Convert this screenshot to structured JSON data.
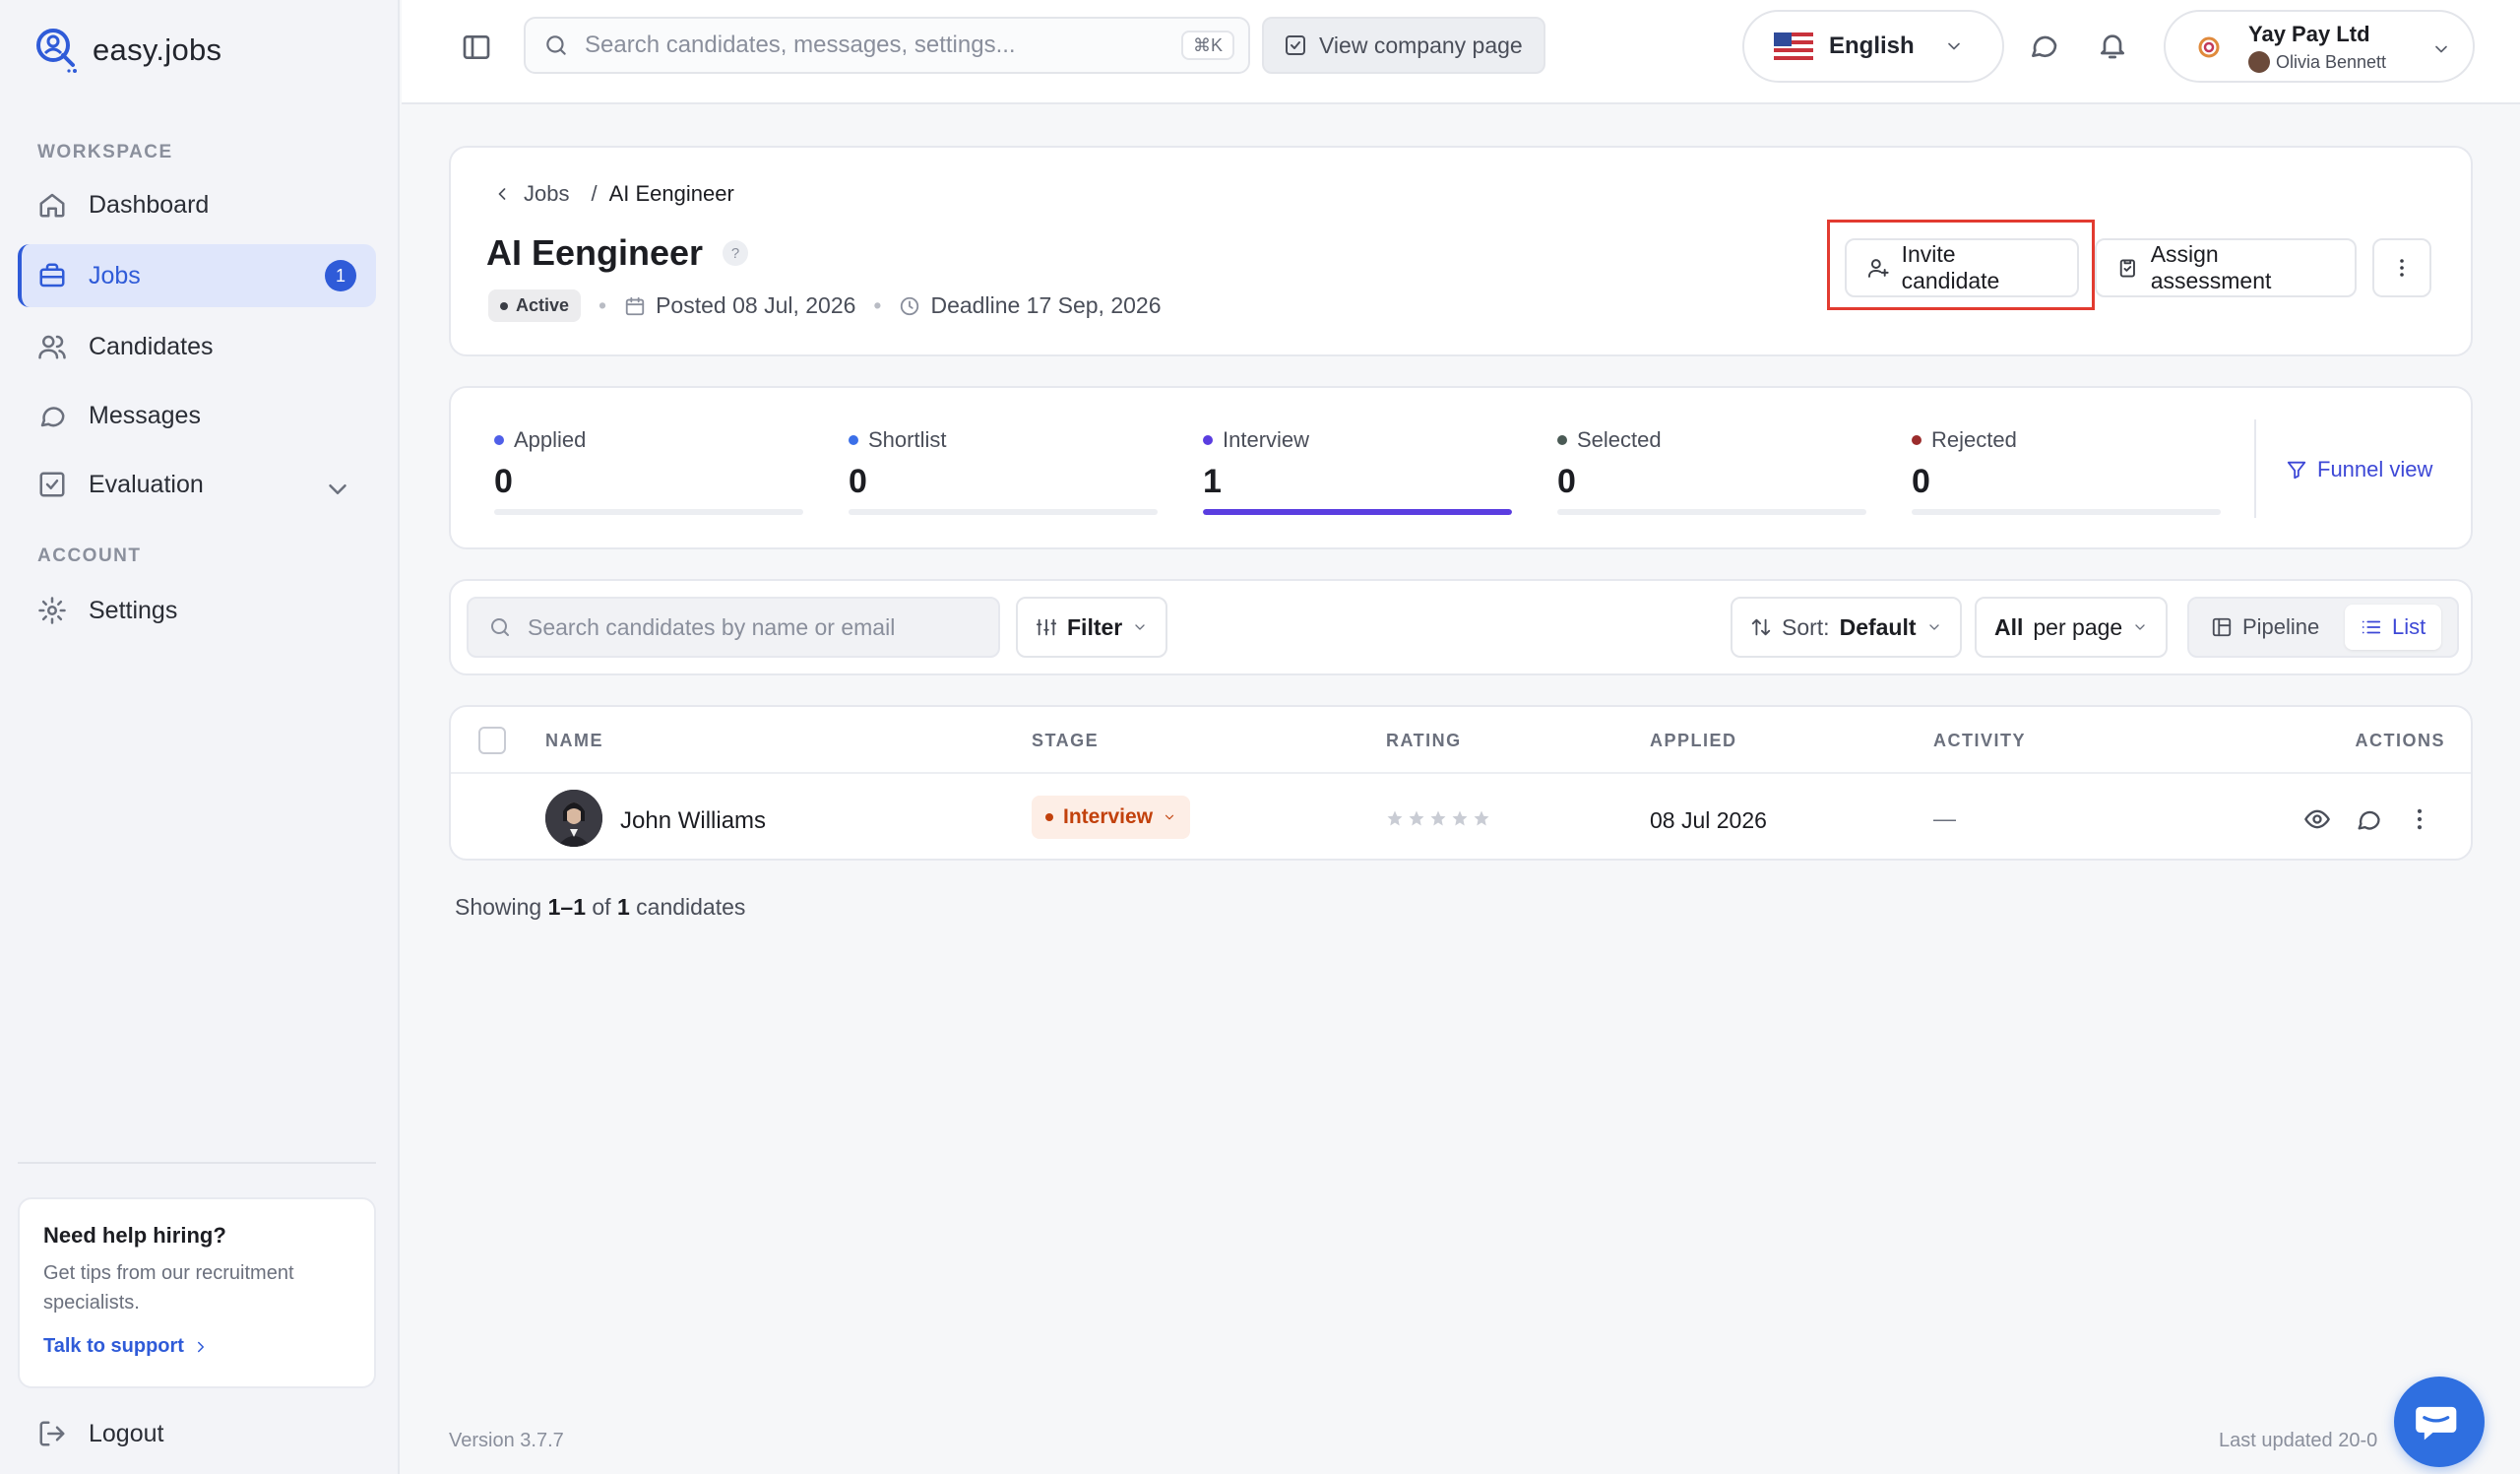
{
  "app": {
    "name": "easy.jobs"
  },
  "sidebar": {
    "workspace_label": "WORKSPACE",
    "account_label": "ACCOUNT",
    "items": [
      {
        "label": "Dashboard",
        "icon": "home-icon"
      },
      {
        "label": "Jobs",
        "icon": "briefcase-icon",
        "badge": "1",
        "active": true
      },
      {
        "label": "Candidates",
        "icon": "users-icon"
      },
      {
        "label": "Messages",
        "icon": "message-icon"
      },
      {
        "label": "Evaluation",
        "icon": "checklist-icon",
        "expandable": true
      }
    ],
    "settings_label": "Settings",
    "help": {
      "title": "Need help hiring?",
      "text": "Get tips from our recruitment specialists.",
      "link": "Talk to support"
    },
    "logout_label": "Logout"
  },
  "topbar": {
    "search_placeholder": "Search candidates, messages, settings...",
    "search_shortcut": "⌘K",
    "view_company_label": "View company page",
    "language": "English",
    "company": "Yay Pay Ltd",
    "user": "Olivia Bennett"
  },
  "job": {
    "breadcrumb_parent": "Jobs",
    "breadcrumb_sep": "/",
    "breadcrumb_current": "AI Eengineer",
    "title": "AI Eengineer",
    "help_mark": "?",
    "status": "Active",
    "posted": "Posted 08 Jul, 2026",
    "deadline": "Deadline 17 Sep, 2026",
    "invite_label": "Invite candidate",
    "assign_label": "Assign assessment"
  },
  "stats": [
    {
      "label": "Applied",
      "value": "0",
      "color": "#4f5fe8",
      "fill": 0
    },
    {
      "label": "Shortlist",
      "value": "0",
      "color": "#3b6fe8",
      "fill": 0
    },
    {
      "label": "Interview",
      "value": "1",
      "color": "#5a3de0",
      "fill": 1
    },
    {
      "label": "Selected",
      "value": "0",
      "color": "#4a5a55",
      "fill": 0
    },
    {
      "label": "Rejected",
      "value": "0",
      "color": "#9b2c2c",
      "fill": 0
    }
  ],
  "funnel_label": "Funnel view",
  "toolbar": {
    "search_placeholder": "Search candidates by name or email",
    "filter_label": "Filter",
    "sort_prefix": "Sort:",
    "sort_value": "Default",
    "per_page_value": "All",
    "per_page_suffix": "per page",
    "view_pipeline": "Pipeline",
    "view_list": "List"
  },
  "table": {
    "columns": [
      "NAME",
      "STAGE",
      "RATING",
      "APPLIED",
      "ACTIVITY",
      "ACTIONS"
    ],
    "rows": [
      {
        "name": "John Williams",
        "stage": "Interview",
        "rating": 0,
        "applied": "08 Jul 2026",
        "activity": "—"
      }
    ]
  },
  "pagination": {
    "prefix": "Showing",
    "range": "1–1",
    "of": "of",
    "total": "1",
    "suffix": "candidates"
  },
  "footer": {
    "version": "Version 3.7.7",
    "updated": "Last updated 20-0"
  },
  "colors": {
    "accent": "#2f5bd8",
    "highlight": "#e23b30",
    "interview": "#c2410c"
  }
}
